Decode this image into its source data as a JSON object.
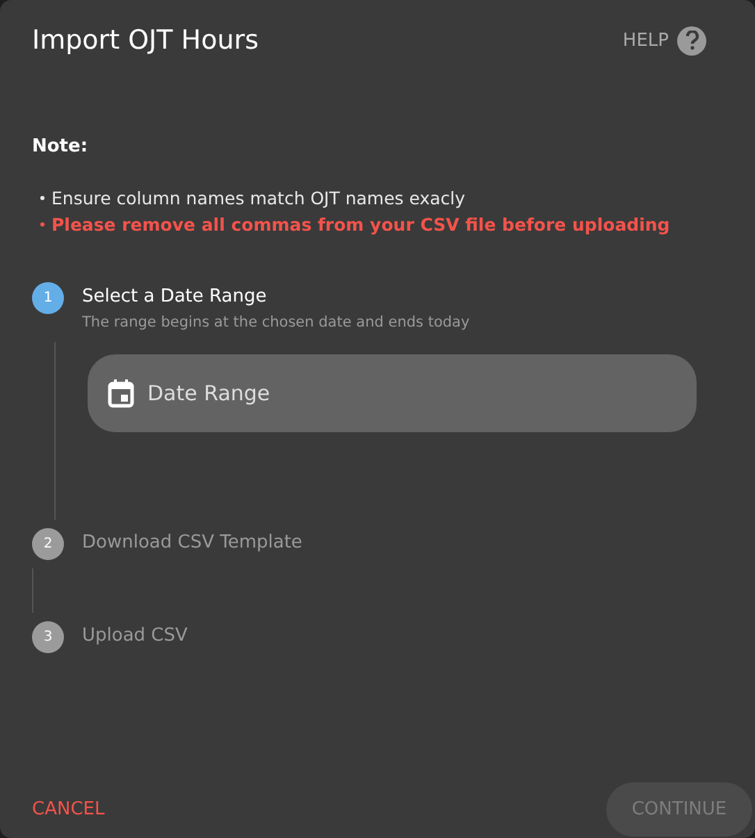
{
  "dialog": {
    "title": "Import OJT Hours",
    "help": "HELP"
  },
  "note": {
    "heading": "Note:",
    "items": [
      {
        "text": "Ensure column names match OJT names exacly",
        "kind": "info"
      },
      {
        "text": "Please remove all commas from your CSV file before uploading",
        "kind": "warning"
      }
    ]
  },
  "steps": [
    {
      "number": "1",
      "title": "Select a Date Range",
      "subtitle": "The range begins at the chosen date and ends today",
      "active": true,
      "field": {
        "placeholder": "Date Range"
      }
    },
    {
      "number": "2",
      "title": "Download CSV Template",
      "active": false
    },
    {
      "number": "3",
      "title": "Upload CSV",
      "active": false
    }
  ],
  "actions": {
    "cancel": "CANCEL",
    "continue": {
      "label": "CONTINUE",
      "disabled": true
    }
  }
}
